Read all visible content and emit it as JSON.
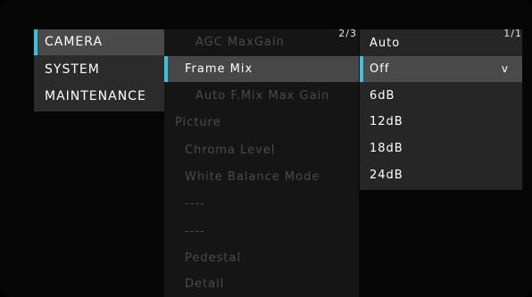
{
  "menu": {
    "items": [
      {
        "label": "CAMERA",
        "selected": true
      },
      {
        "label": "SYSTEM",
        "selected": false
      },
      {
        "label": "MAINTENANCE",
        "selected": false
      }
    ]
  },
  "submenu": {
    "page": "2/3",
    "items": [
      {
        "label": "AGC MaxGain"
      },
      {
        "label": "Frame Mix"
      },
      {
        "label": "Auto F.Mix Max Gain"
      },
      {
        "label": "Picture"
      },
      {
        "label": "Chroma Level"
      },
      {
        "label": "White Balance Mode"
      },
      {
        "label": "----"
      },
      {
        "label": "----"
      },
      {
        "label": "Pedestal"
      },
      {
        "label": "Detail"
      }
    ]
  },
  "options": {
    "page": "1/1",
    "dropdown_indicator": "v",
    "items": [
      {
        "label": "Auto"
      },
      {
        "label": "Off"
      },
      {
        "label": "6dB"
      },
      {
        "label": "12dB"
      },
      {
        "label": "18dB"
      },
      {
        "label": "24dB"
      }
    ]
  },
  "colors": {
    "accent": "#35c4dc",
    "selected_bg": "#4a4a4a",
    "dimmed_text": "#4b4b4b"
  }
}
